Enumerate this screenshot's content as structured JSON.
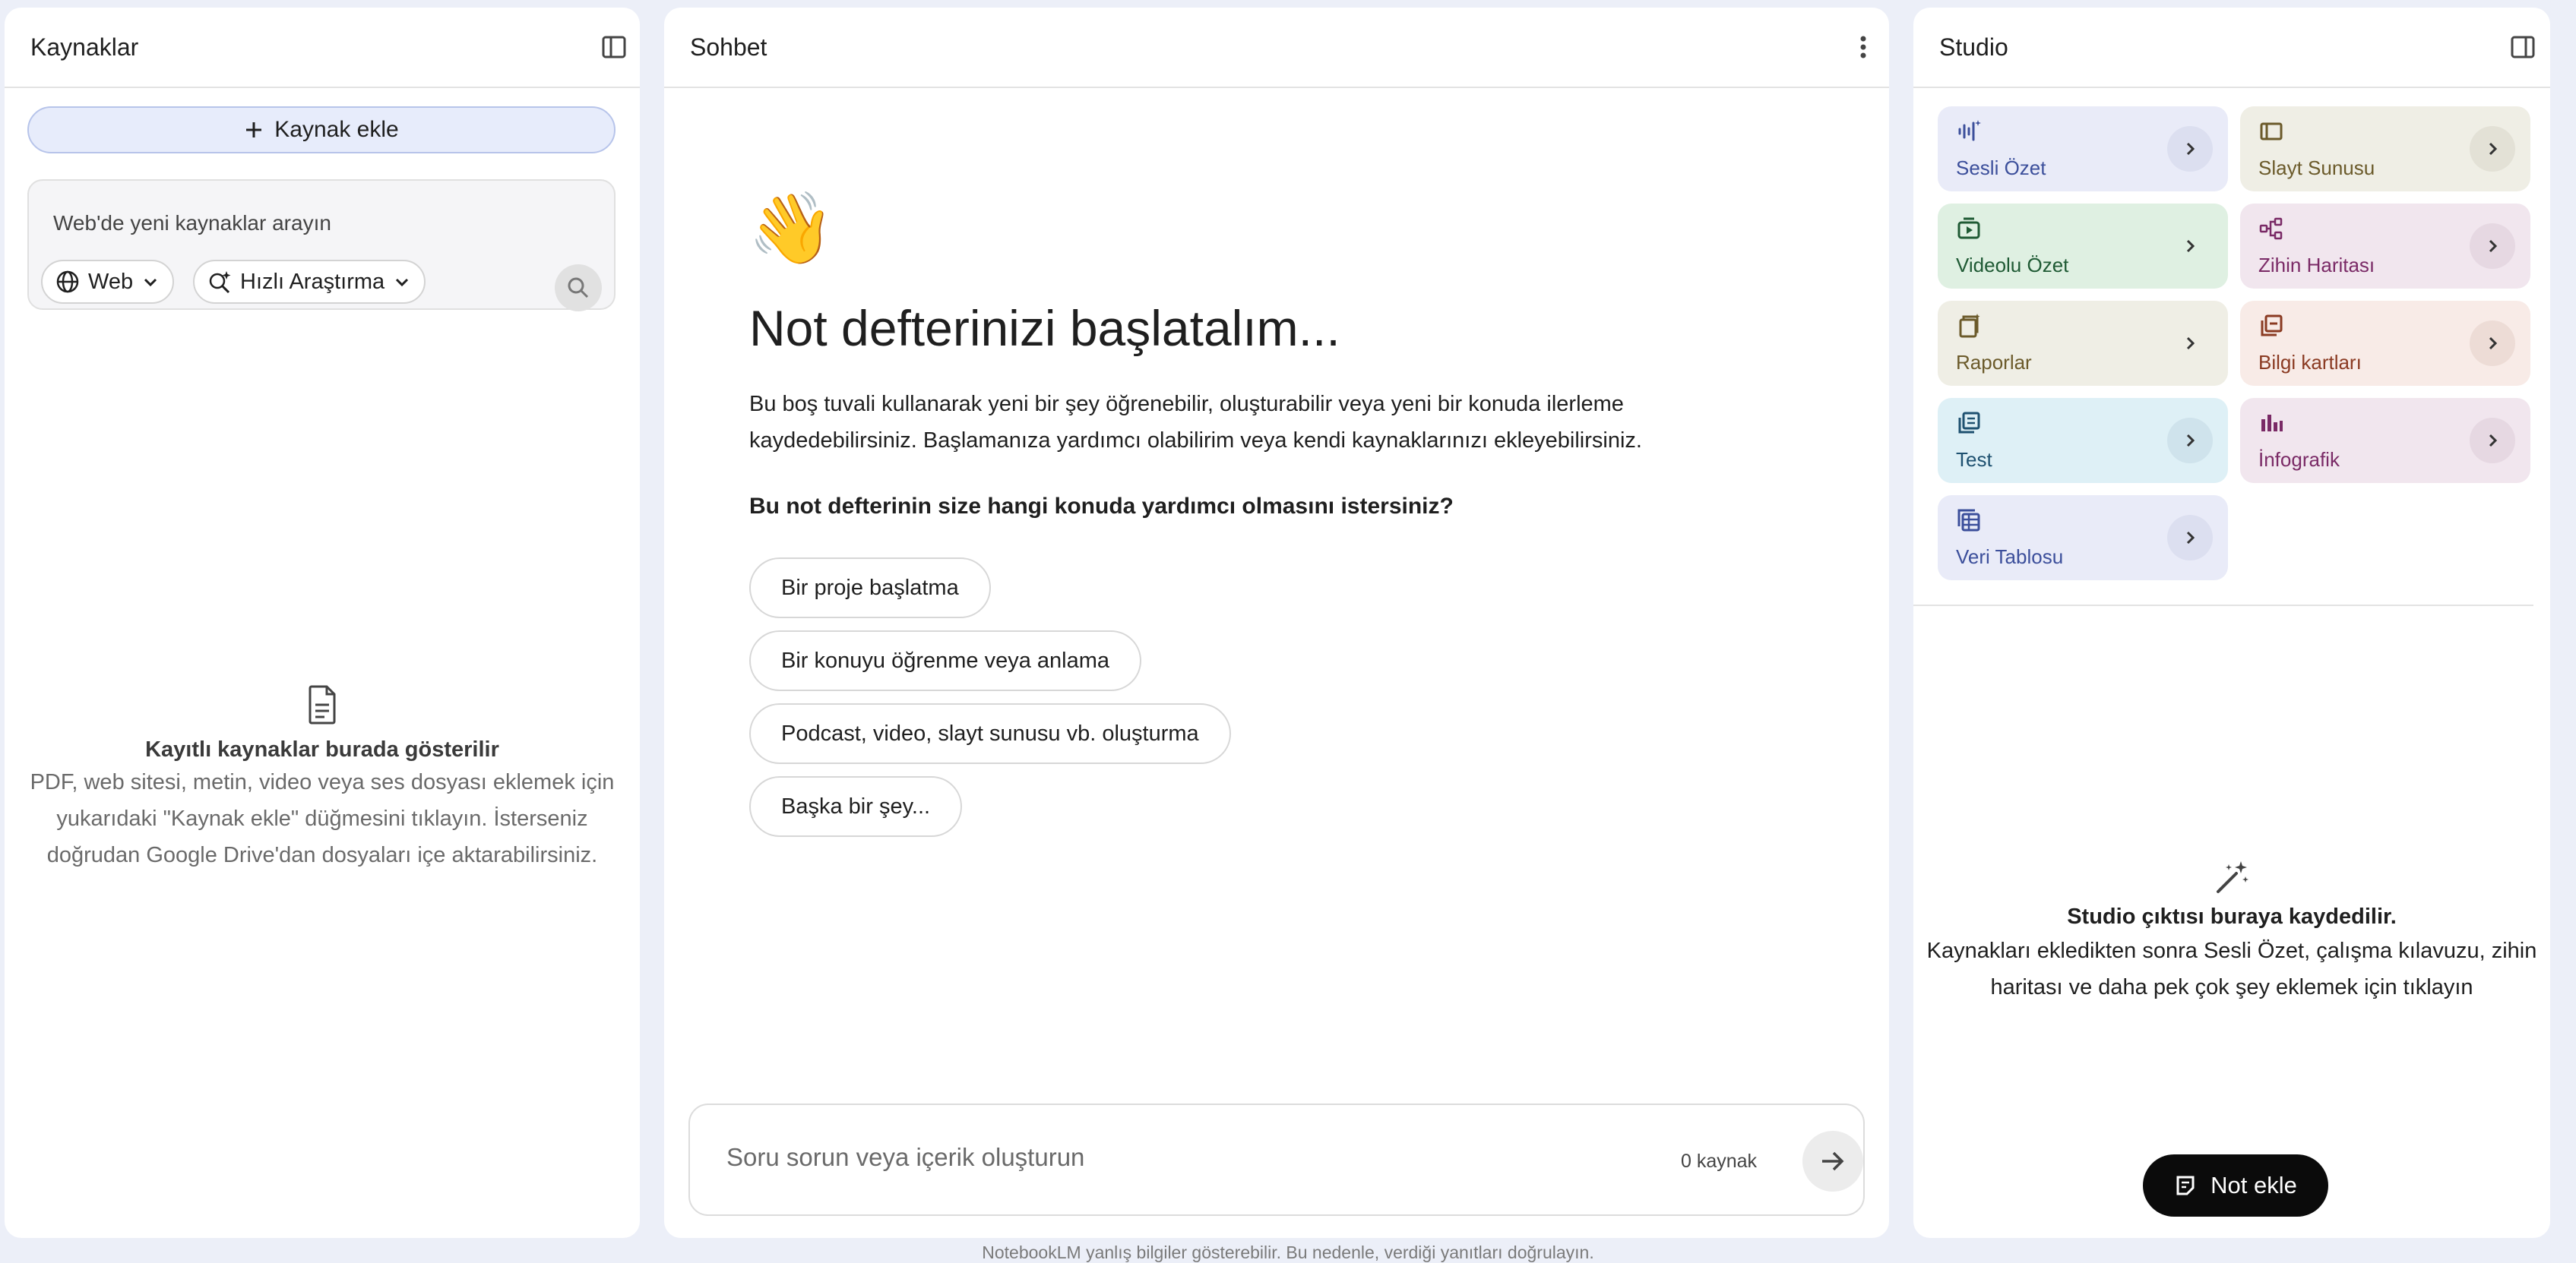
{
  "sources_panel": {
    "title": "Kaynaklar",
    "add_source_label": "Kaynak ekle",
    "search_placeholder": "Web'de yeni kaynaklar arayın",
    "web_chip_label": "Web",
    "research_chip_label": "Hızlı Araştırma",
    "empty_title": "Kayıtlı kaynaklar burada gösterilir",
    "empty_desc_1": "PDF, web sitesi, metin, video veya ses dosyası eklemek için",
    "empty_desc_2": "yukarıdaki \"Kaynak ekle\" düğmesini tıklayın. İsterseniz",
    "empty_desc_3": "doğrudan Google Drive'dan dosyaları içe aktarabilirsiniz."
  },
  "chat_panel": {
    "title": "Sohbet",
    "wave_emoji": "👋",
    "heading": "Not defterinizi başlatalım...",
    "intro_line_1": "Bu boş tuvali kullanarak yeni bir şey öğrenebilir, oluşturabilir veya yeni bir konuda ilerleme",
    "intro_line_2": "kaydedebilirsiniz. Başlamanıza yardımcı olabilirim veya kendi kaynaklarınızı ekleyebilirsiniz.",
    "question": "Bu not defterinin size hangi konuda yardımcı olmasını istersiniz?",
    "suggestions": [
      "Bir proje başlatma",
      "Bir konuyu öğrenme veya anlama",
      "Podcast, video, slayt sunusu vb. oluşturma",
      "Başka bir şey..."
    ],
    "input_placeholder": "Soru sorun veya içerik oluşturun",
    "source_count": "0 kaynak"
  },
  "studio_panel": {
    "title": "Studio",
    "cards": [
      {
        "label": "Sesli Özet",
        "icon": "audio-waveform-icon",
        "color": "#3c4f9b"
      },
      {
        "label": "Slayt Sunusu",
        "icon": "slides-icon",
        "color": "#6b5a2a"
      },
      {
        "label": "Videolu Özet",
        "icon": "video-icon",
        "color": "#1f5a34"
      },
      {
        "label": "Zihin Haritası",
        "icon": "mind-map-icon",
        "color": "#7a2a66"
      },
      {
        "label": "Raporlar",
        "icon": "reports-icon",
        "color": "#6b5a2a"
      },
      {
        "label": "Bilgi kartları",
        "icon": "flashcards-icon",
        "color": "#8a3a22"
      },
      {
        "label": "Test",
        "icon": "quiz-icon",
        "color": "#1e5170"
      },
      {
        "label": "İnfografik",
        "icon": "infographic-icon",
        "color": "#7a2a66"
      },
      {
        "label": "Veri Tablosu",
        "icon": "data-table-icon",
        "color": "#3c4f9b"
      }
    ],
    "empty_title": "Studio çıktısı buraya kaydedilir.",
    "empty_desc_1": "Kaynakları ekledikten sonra Sesli Özet, çalışma kılavuzu, zihin",
    "empty_desc_2": "haritası ve daha pek çok şey eklemek için tıklayın",
    "add_note_label": "Not ekle"
  },
  "footer": {
    "disclaimer": "NotebookLM yanlış bilgiler gösterebilir. Bu nedenle, verdiği yanıtları doğrulayın."
  }
}
